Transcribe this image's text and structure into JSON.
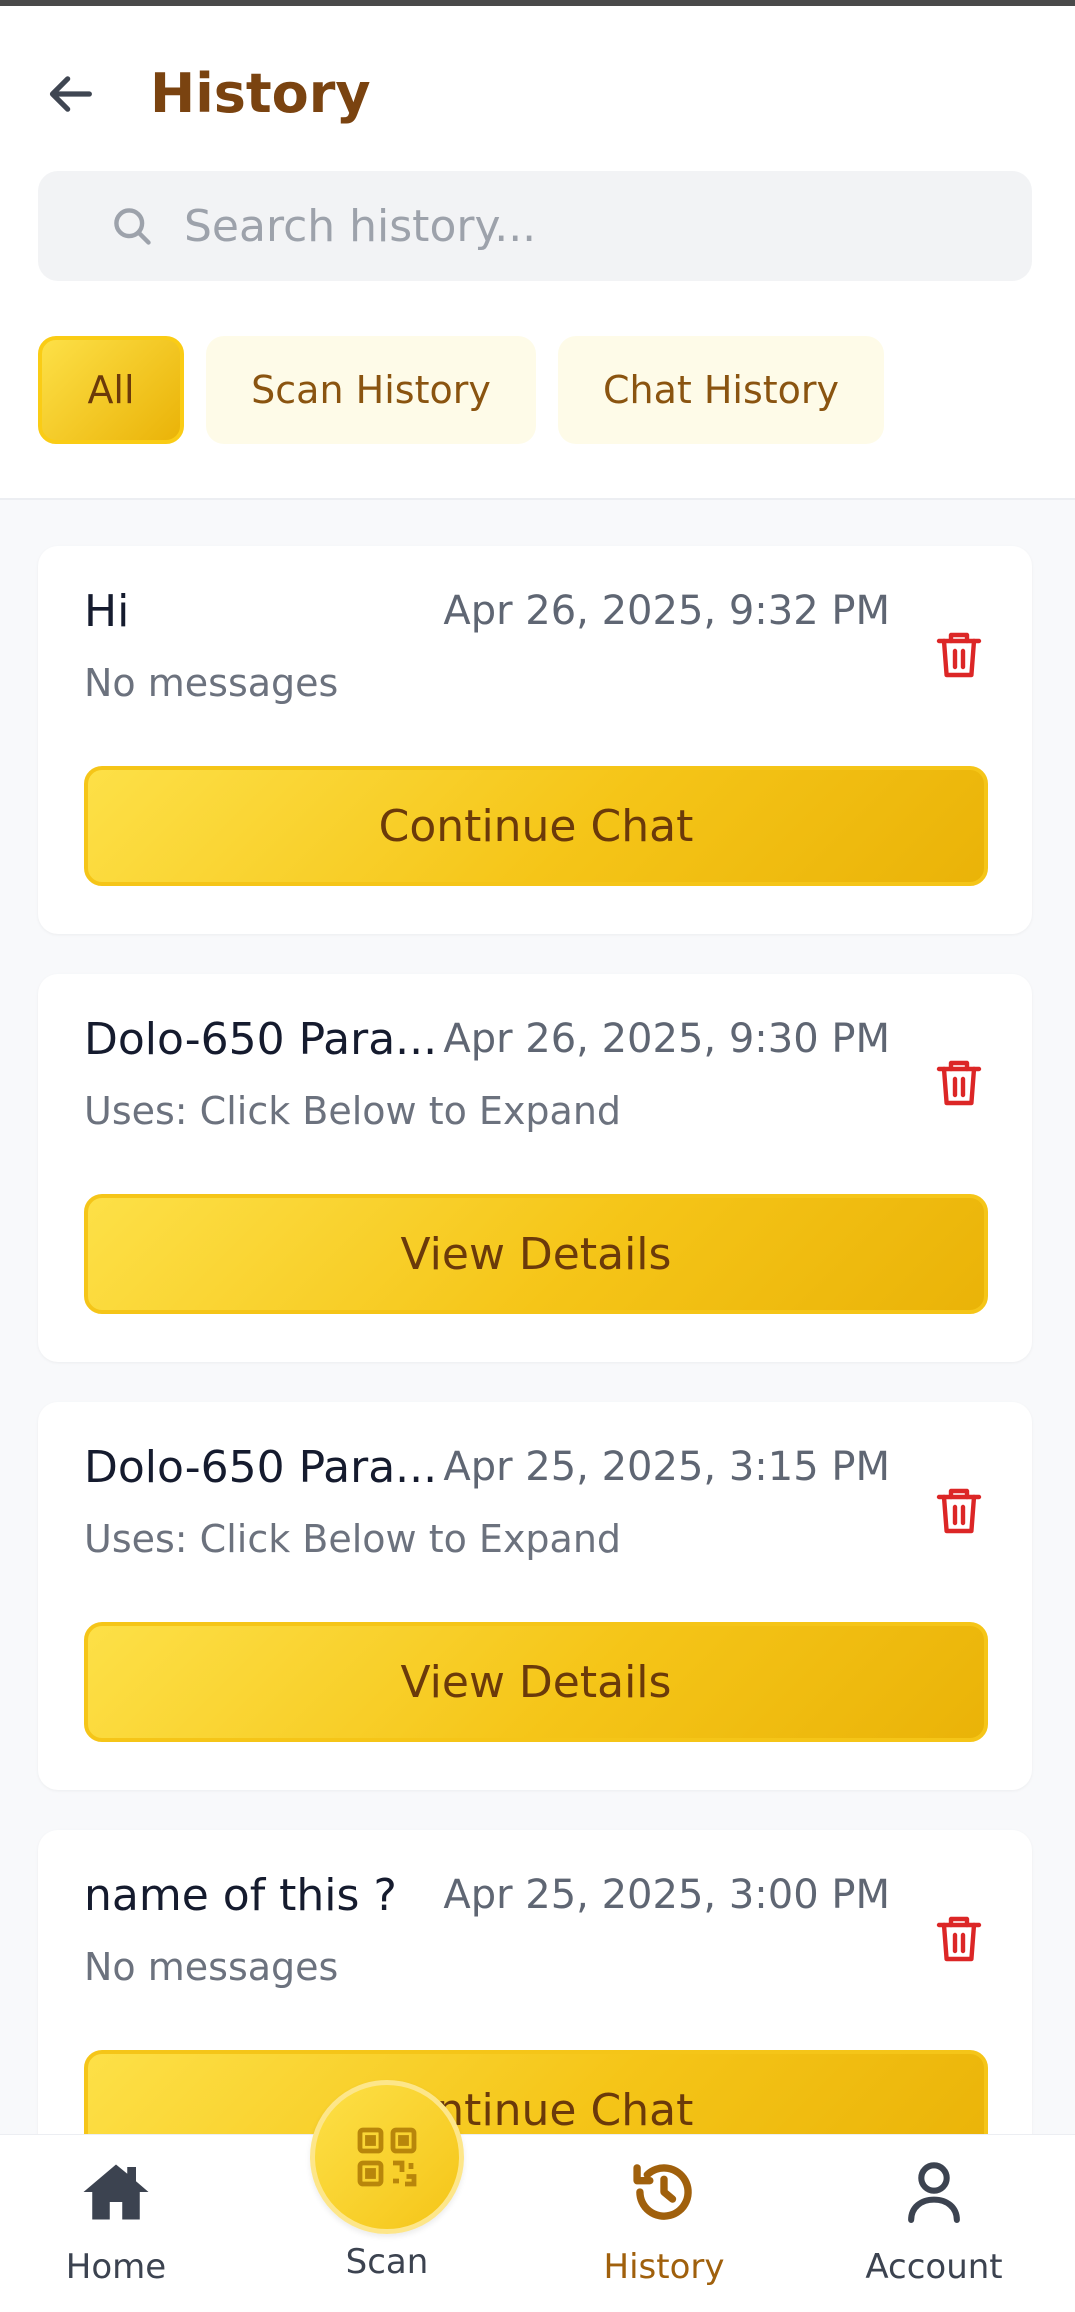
{
  "header": {
    "title": "History",
    "back_icon": "arrow-left-icon"
  },
  "search": {
    "placeholder": "Search history...",
    "value": "",
    "icon": "search-icon"
  },
  "filters": [
    {
      "label": "All",
      "active": true
    },
    {
      "label": "Scan History",
      "active": false
    },
    {
      "label": "Chat History",
      "active": false
    }
  ],
  "items": [
    {
      "title": "Hi",
      "date": "Apr 26, 2025, 9:32 PM",
      "subtitle": "No messages",
      "action": "Continue Chat"
    },
    {
      "title": "Dolo-650 Para...",
      "date": "Apr 26, 2025, 9:30 PM",
      "subtitle": "Uses: Click Below to Expand",
      "action": "View Details"
    },
    {
      "title": "Dolo-650 Para...",
      "date": "Apr 25, 2025, 3:15 PM",
      "subtitle": "Uses: Click Below to Expand",
      "action": "View Details"
    },
    {
      "title": "name of this ?",
      "date": "Apr 25, 2025, 3:00 PM",
      "subtitle": "No messages",
      "action": "Continue Chat"
    }
  ],
  "nav": {
    "home": "Home",
    "scan": "Scan",
    "history": "History",
    "account": "Account",
    "active": "History"
  },
  "colors": {
    "accent": "#eab308",
    "title": "#7a4310",
    "danger": "#dc2626",
    "active_nav": "#a0600c"
  }
}
